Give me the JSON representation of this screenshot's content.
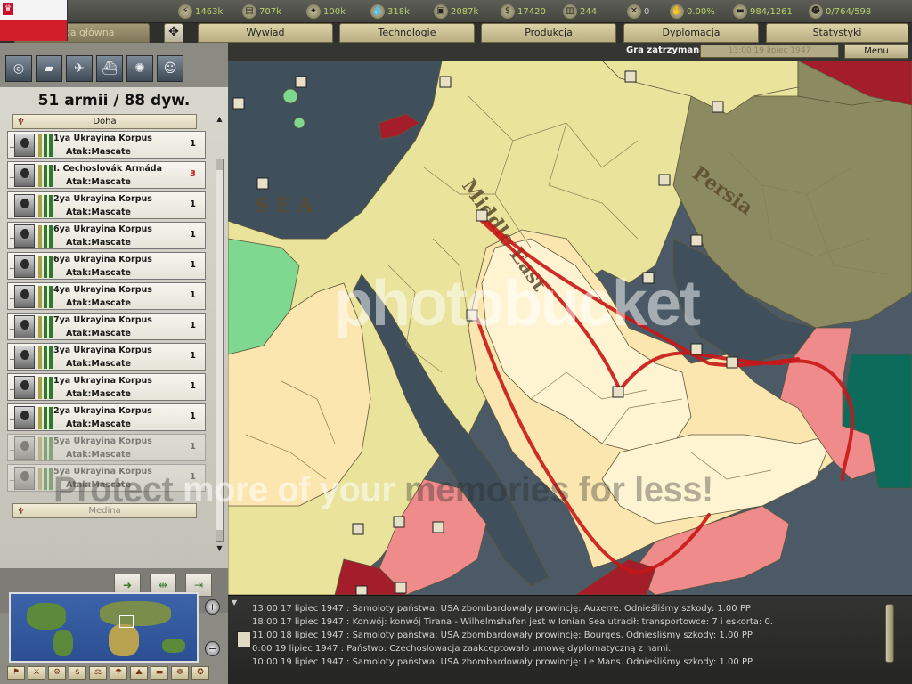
{
  "resources": [
    {
      "icon": "energy-icon",
      "glyph": "⚡",
      "value": "1463k"
    },
    {
      "icon": "metal-icon",
      "glyph": "▤",
      "value": "707k"
    },
    {
      "icon": "rare-materials-icon",
      "glyph": "✦",
      "value": "100k"
    },
    {
      "icon": "oil-icon",
      "glyph": "💧",
      "value": "318k"
    },
    {
      "icon": "supplies-icon",
      "glyph": "▣",
      "value": "2087k"
    },
    {
      "icon": "money-icon",
      "glyph": "$",
      "value": "17420"
    },
    {
      "icon": "industrial-capacity-icon",
      "glyph": "▥",
      "value": "244"
    },
    {
      "icon": "transports-icon",
      "glyph": "✕",
      "value": "0"
    },
    {
      "icon": "dissent-icon",
      "glyph": "✋",
      "value": "0.00%"
    },
    {
      "icon": "convoys-icon",
      "glyph": "▬",
      "value": "984/1261"
    },
    {
      "icon": "manpower-icon",
      "glyph": "☻",
      "value": "0/764/598"
    }
  ],
  "tabs": {
    "main_map": "Mapa główna",
    "intelligence": "Wywiad",
    "technology": "Technologie",
    "production": "Produkcja",
    "diplomacy": "Dyplomacja",
    "statistics": "Statystyki",
    "map_mode_glyph": "✥"
  },
  "status": {
    "paused": "Gra zatrzymana",
    "date": "13:00 19 lipiec 1947",
    "menu": "Menu"
  },
  "army": {
    "count": "51 armii / 88 dyw.",
    "group_top": "Doha",
    "group_bottom": "Medina",
    "units": [
      {
        "name": "1ya Ukrayina Korpus",
        "mission": "Atak:Mascate",
        "count": "1"
      },
      {
        "name": "I. Cechoslovák Armáda",
        "mission": "Atak:Mascate",
        "count": "3"
      },
      {
        "name": "2ya Ukrayina Korpus",
        "mission": "Atak:Mascate",
        "count": "1"
      },
      {
        "name": "6ya Ukrayina Korpus",
        "mission": "Atak:Mascate",
        "count": "1"
      },
      {
        "name": "6ya Ukrayina Korpus",
        "mission": "Atak:Mascate",
        "count": "1"
      },
      {
        "name": "4ya Ukrayina Korpus",
        "mission": "Atak:Mascate",
        "count": "1"
      },
      {
        "name": "7ya Ukrayina Korpus",
        "mission": "Atak:Mascate",
        "count": "1"
      },
      {
        "name": "3ya Ukrayina Korpus",
        "mission": "Atak:Mascate",
        "count": "1"
      },
      {
        "name": "1ya Ukrayina Korpus",
        "mission": "Atak:Mascate",
        "count": "1"
      },
      {
        "name": "2ya Ukrayina Korpus",
        "mission": "Atak:Mascate",
        "count": "1"
      },
      {
        "name": "5ya Ukrayina Korpus",
        "mission": "Atak:Mascate",
        "count": "1"
      },
      {
        "name": "5ya Ukrayina Korpus",
        "mission": "Atak:Mascate",
        "count": "1"
      }
    ]
  },
  "map": {
    "label_sea": "S E A",
    "label_persia": "Persia",
    "label_middle_east": "Middle East",
    "colors": {
      "sea": "#4b5a66",
      "deep_sea": "#3f4f5c",
      "yellow_land": "#e9e39c",
      "light_land": "#fbe6b0",
      "pale_land": "#fff4d2",
      "persia": "#8b8a60",
      "red_land": "#ef8b8b",
      "dark_red": "#a41d2a",
      "green_land": "#7fd88f",
      "teal_land": "#0d6b5c",
      "route": "#c91616"
    }
  },
  "messages": [
    "13:00 17 lipiec 1947 : Samoloty państwa: USA zbombardowały prowincję: Auxerre. Odnieśliśmy szkody: 1.00 PP",
    "18:00 17 lipiec 1947 : Konwój: konwój Tirana - Wilhelmshafen jest w Ionian Sea utracił: transportowce: 7 i eskorta: 0.",
    "11:00 18 lipiec 1947 : Samoloty państwa: USA zbombardowały prowincję: Bourges. Odnieśliśmy szkody: 1.00 PP",
    "0:00 19 lipiec 1947 : Państwo: Czechosłowacja zaakceptowało umowę dyplomatyczną z nami.",
    "10:00 19 lipiec 1947 : Samoloty państwa: USA zbombardowały prowincję: Le Mans. Odnieśliśmy szkody: 1.00 PP"
  ],
  "watermark": {
    "logo": "photobucket",
    "protect": "Protect",
    "more_of_your": "more of your",
    "memories": "memories",
    "for_less": "for less!"
  }
}
